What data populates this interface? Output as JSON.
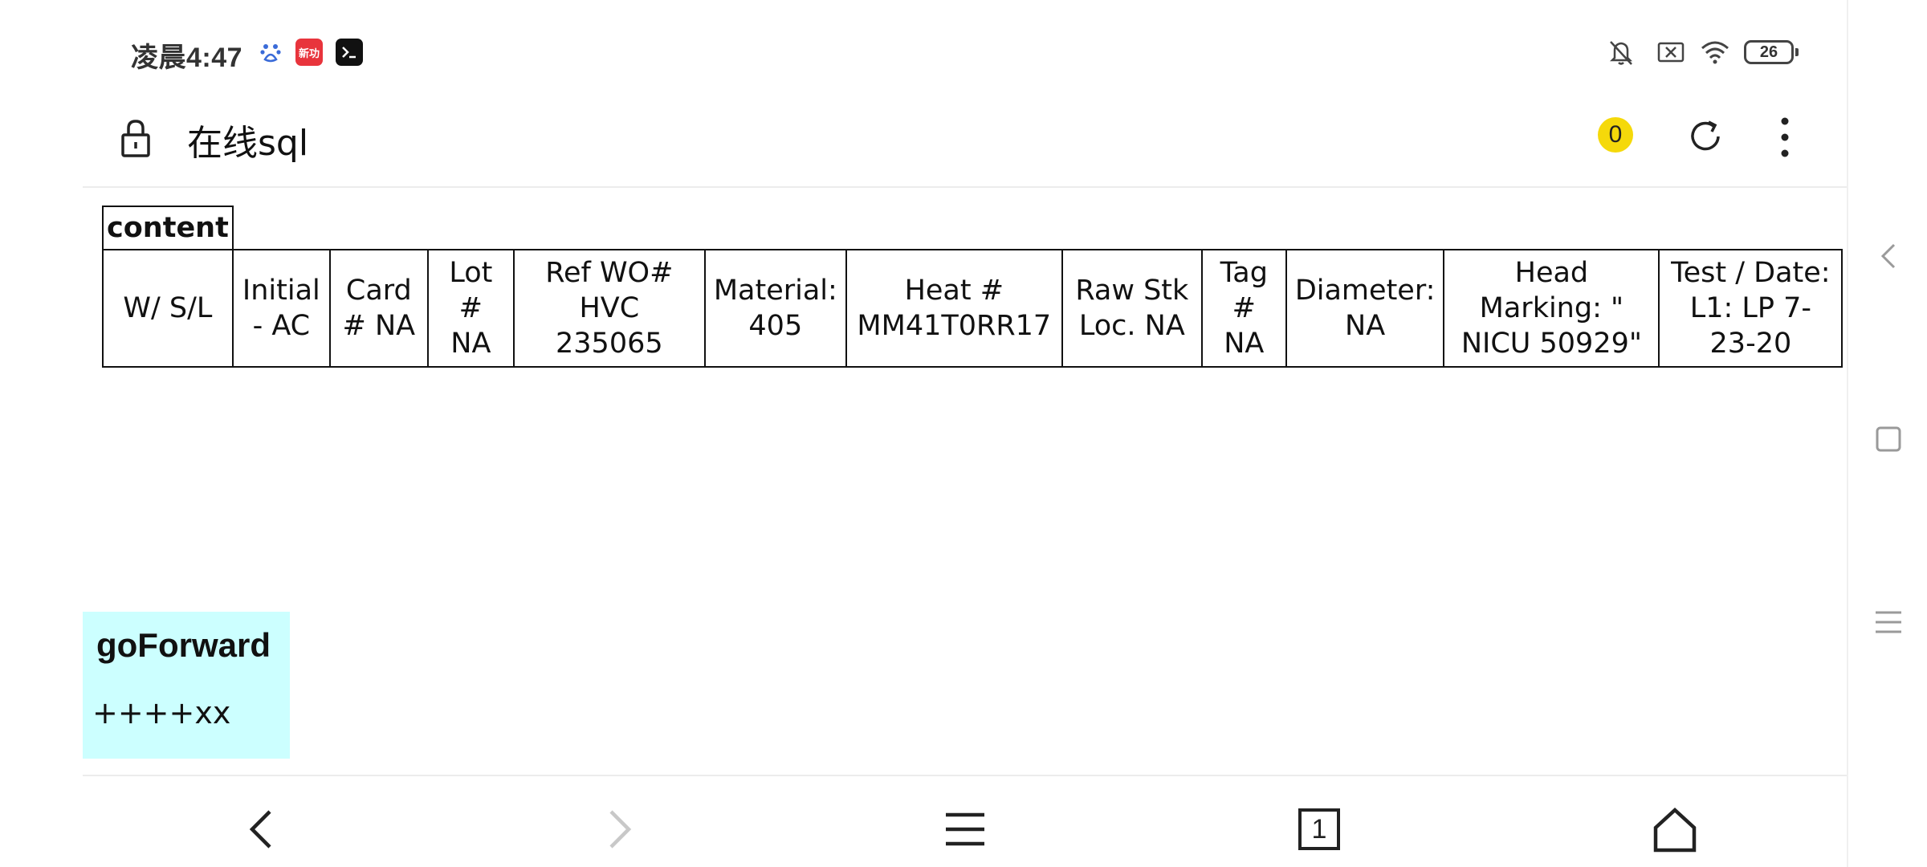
{
  "status_bar": {
    "time": "凌晨4:47",
    "app_icons": [
      "baidu-paw-icon",
      "news-app-icon",
      "terminal-app-icon"
    ],
    "news_icon_label": "新功",
    "right_icons": [
      "mute-bell-icon",
      "sim-off-icon",
      "wifi-icon",
      "battery-icon"
    ],
    "battery_level": "26"
  },
  "toolbar": {
    "title": "在线sql",
    "tab_count": "0"
  },
  "table": {
    "header": "content",
    "cells": [
      "W/ S/L",
      "Initial - AC",
      "Card # NA",
      "Lot # NA",
      "Ref WO# HVC 235065",
      "Material: 405",
      "Heat # MM41T0RR17",
      "Raw Stk Loc. NA",
      "Tag # NA",
      "Diameter: NA",
      "Head Marking: \" NICU 50929\"",
      "Test / Date: L1: LP 7-23-20"
    ]
  },
  "go_forward": {
    "title": "goForward",
    "text": "++++xx"
  },
  "bottom_nav": {
    "buttons": [
      "back",
      "forward",
      "menu",
      "tabs",
      "home"
    ],
    "tabs_count": "1"
  },
  "colors": {
    "badge": "#f5d90a",
    "go_forward_bg": "#ccffff",
    "news_icon": "#e8343c"
  }
}
